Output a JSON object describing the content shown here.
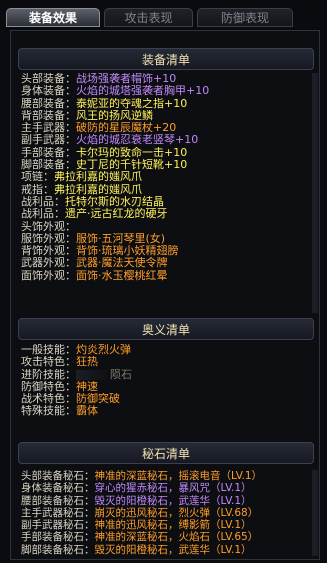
{
  "tabs": [
    {
      "label": "装备效果",
      "active": true
    },
    {
      "label": "攻击表现",
      "active": false
    },
    {
      "label": "防御表现",
      "active": false
    }
  ],
  "equipment": {
    "title": "装备清单",
    "rows": [
      {
        "label": "头部装备：",
        "value": "战场强袭者帽饰+10",
        "color": "purple"
      },
      {
        "label": "身体装备：",
        "value": "火焰的城塔强袭者胸甲+10",
        "color": "purple"
      },
      {
        "label": "腰部装备：",
        "value": "泰妮亚的夺魂之指+10",
        "color": "yellow"
      },
      {
        "label": "背部装备：",
        "value": "风王的扬风逆鳞",
        "color": "yellow"
      },
      {
        "label": "主手武器：",
        "value": "破防的星辰魔杖+20",
        "color": "orange"
      },
      {
        "label": "副手武器：",
        "value": "火焰的城忍衰老竖琴+10",
        "color": "purple"
      },
      {
        "label": "手部装备：",
        "value": "卡尔玛的致命一击+10",
        "color": "yellow"
      },
      {
        "label": "脚部装备：",
        "value": "史丁尼的千针短靴+10",
        "color": "yellow"
      },
      {
        "label": "项链：",
        "value": "弗拉利嘉的媸风爪",
        "color": "yellow"
      },
      {
        "label": "戒指：",
        "value": "弗拉利嘉的媸风爪",
        "color": "yellow"
      },
      {
        "label": "战利品：",
        "value": "托特尔斯的水刃结晶",
        "color": "yellow"
      },
      {
        "label": "战利品：",
        "value": "遗产·远古红龙的硬牙",
        "color": "yellow"
      },
      {
        "label": "头饰外观：",
        "value": "",
        "color": "yellow"
      },
      {
        "label": "服饰外观：",
        "value": "服饰·五河琴里(女)",
        "color": "orange"
      },
      {
        "label": "背饰外观：",
        "value": "背饰·琉璃小妖精翅膀",
        "color": "orange"
      },
      {
        "label": "武器外观：",
        "value": "武器·魔法天使令牌",
        "color": "orange"
      },
      {
        "label": "面饰外观：",
        "value": "面饰·水玉樱桃红晕",
        "color": "orange"
      }
    ]
  },
  "secret": {
    "title": "奥义清单",
    "rows": [
      {
        "label": "一般技能：",
        "value": "灼炎烈火弹",
        "color": "orange"
      },
      {
        "label": "攻击特色：",
        "value": "狂热",
        "color": "orange"
      },
      {
        "label": "进阶技能：",
        "value": "陨石",
        "color": "gray"
      },
      {
        "label": "防御特色：",
        "value": "神速",
        "color": "orange"
      },
      {
        "label": "战术特色：",
        "value": "防御突破",
        "color": "orange"
      },
      {
        "label": "特殊技能：",
        "value": "霸体",
        "color": "orange"
      }
    ]
  },
  "runes": {
    "title": "秘石清单",
    "rows": [
      {
        "label": "头部装备秘石：",
        "value": "神准的深蓝秘石，摇滚电音（LV.1）",
        "color": "orange"
      },
      {
        "label": "身体装备秘石：",
        "value": "穿心的猩赤秘石，暴风咒（LV.1）",
        "color": "purple"
      },
      {
        "label": "腰部装备秘石：",
        "value": "毁灭的阳橙秘石，武莲华（LV.1）",
        "color": "purple"
      },
      {
        "label": "主手武器秘石：",
        "value": "崩灭的迅风秘石，烈火弹（LV.68）",
        "color": "orange"
      },
      {
        "label": "副手武器秘石：",
        "value": "神准的迅风秘石，缚影箭（LV.1）",
        "color": "orange"
      },
      {
        "label": "手部装备秘石：",
        "value": "神准的深蓝秘石，火焰石（LV.65）",
        "color": "orange"
      },
      {
        "label": "脚部装备秘石：",
        "value": "毁灭的阳橙秘石，武莲华（LV.1）",
        "color": "orange"
      }
    ]
  }
}
